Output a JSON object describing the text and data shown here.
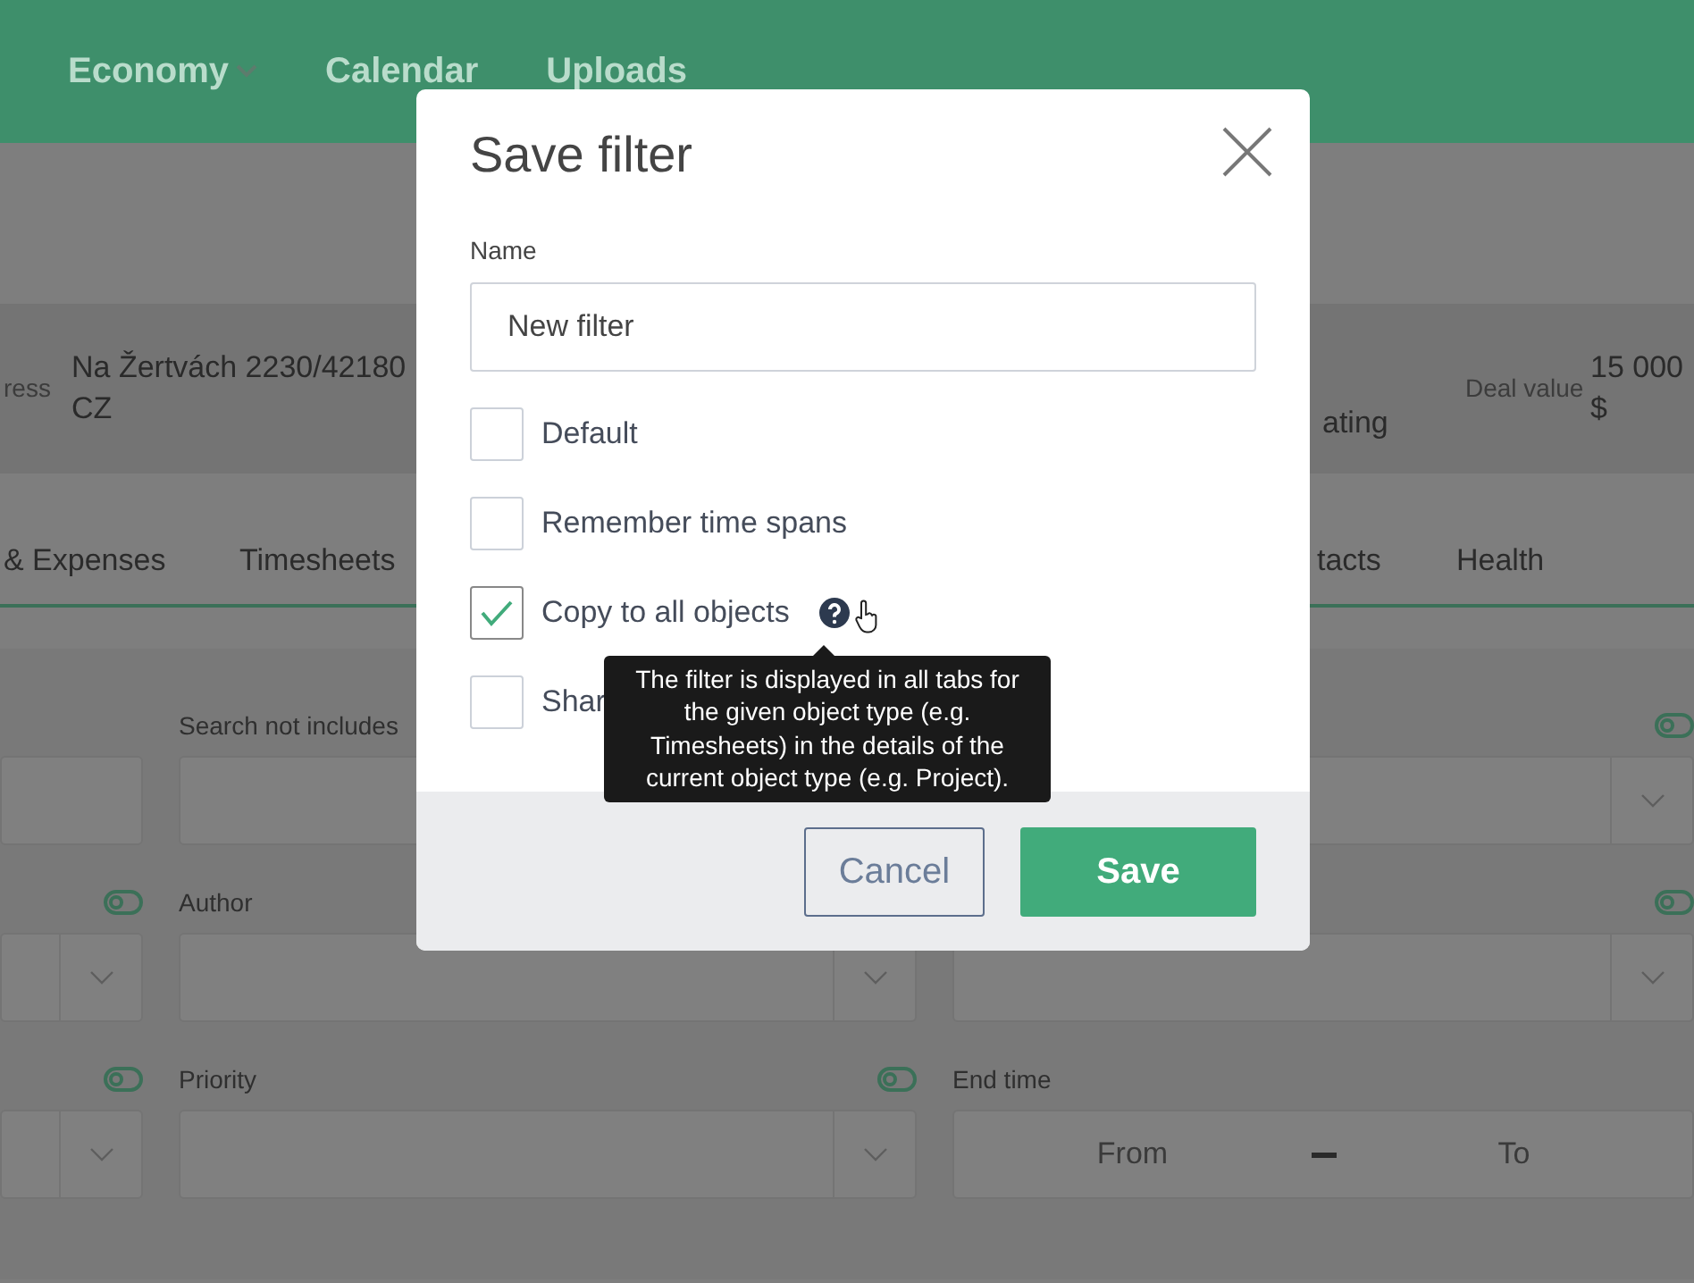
{
  "navbar": {
    "items": [
      {
        "label": "Economy",
        "dropdown": true
      },
      {
        "label": "Calendar",
        "dropdown": false
      },
      {
        "label": "Uploads",
        "dropdown": false
      }
    ]
  },
  "info": [
    {
      "label": "ress",
      "lines": [
        "Na Žertvách 2230/42180",
        "CZ"
      ]
    },
    {
      "lines": [
        "ating"
      ]
    },
    {
      "label": "Deal value",
      "lines": [
        "15 000",
        "$"
      ]
    }
  ],
  "tabs": [
    {
      "label": "& Expenses"
    },
    {
      "label": "Timesheets"
    },
    {
      "label": "tacts"
    },
    {
      "label": "Health"
    }
  ],
  "filter_rows": [
    [
      {
        "kind": "text"
      },
      {
        "label": "Search not includes",
        "kind": "text"
      },
      {
        "toggle": {
          "on": false
        },
        "kind": "select"
      }
    ],
    [
      {
        "toggle": {
          "on": false
        },
        "kind": "select"
      },
      {
        "label": "Author",
        "kind": "select"
      },
      {
        "toggle": {
          "on": false
        },
        "kind": "select"
      }
    ],
    [
      {
        "toggle": {
          "on": false
        },
        "kind": "select"
      },
      {
        "label": "Priority",
        "toggle": {
          "on": false
        },
        "kind": "select"
      },
      {
        "label": "End time",
        "kind": "range",
        "from": "From",
        "to": "To"
      }
    ]
  ],
  "modal": {
    "title": "Save filter",
    "name_label": "Name",
    "name_value": "New filter",
    "options": [
      {
        "label": "Default",
        "checked": false,
        "help": false
      },
      {
        "label": "Remember time spans",
        "checked": false,
        "help": false
      },
      {
        "label": "Copy to all objects",
        "checked": true,
        "help": true
      },
      {
        "label": "Shar",
        "checked": false,
        "help": false
      }
    ],
    "tooltip": "The filter is displayed in all tabs for the given object type (e.g. Timesheets) in the details of the current object type (e.g. Project).",
    "buttons": [
      {
        "label": "Cancel",
        "kind": "secondary"
      },
      {
        "label": "Save",
        "kind": "primary"
      }
    ]
  }
}
